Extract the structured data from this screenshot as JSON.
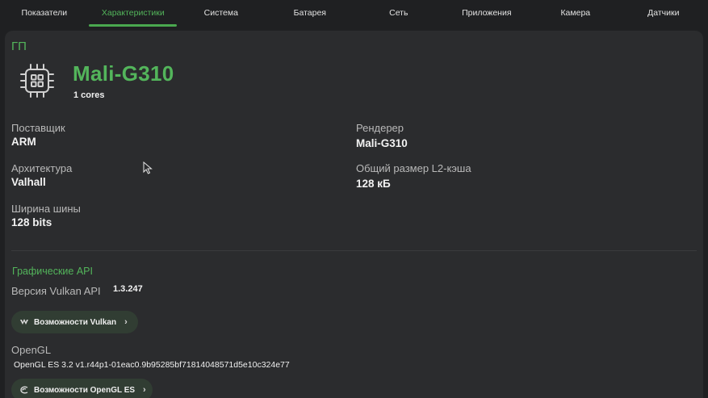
{
  "tabs": [
    {
      "label": "Показатели"
    },
    {
      "label": "Характеристики"
    },
    {
      "label": "Система"
    },
    {
      "label": "Батарея"
    },
    {
      "label": "Сеть"
    },
    {
      "label": "Приложения"
    },
    {
      "label": "Камера"
    },
    {
      "label": "Датчики"
    }
  ],
  "active_tab": "Характеристики",
  "gpu": {
    "section_title": "ГП",
    "name": "Mali-G310",
    "cores": "1 cores",
    "icon": "gpu-chip-icon",
    "fields": {
      "vendor_label": "Поставщик",
      "vendor_value": "ARM",
      "renderer_label": "Рендерер",
      "renderer_value": "Mali-G310",
      "arch_label": "Архитектура",
      "arch_value": "Valhall",
      "l2_label": "Общий размер L2-кэша",
      "l2_value": "128 кБ",
      "bus_label": "Ширина шины",
      "bus_value": "128 bits"
    }
  },
  "graphics_api": {
    "section_title": "Графические API",
    "vulkan_label": "Версия Vulkan API",
    "vulkan_value": "1.3.247",
    "vulkan_button": "Возможности Vulkan",
    "opengl_label": "OpenGL",
    "opengl_value": "OpenGL ES 3.2 v1.r44p1-01eac0.9b95285bf71814048571d5e10c324e77",
    "opengl_button": "Возможности OpenGL ES"
  },
  "colors": {
    "accent": "#53b55b",
    "background": "#1f2022",
    "card": "#2b2c2e",
    "pill": "#313d33"
  }
}
